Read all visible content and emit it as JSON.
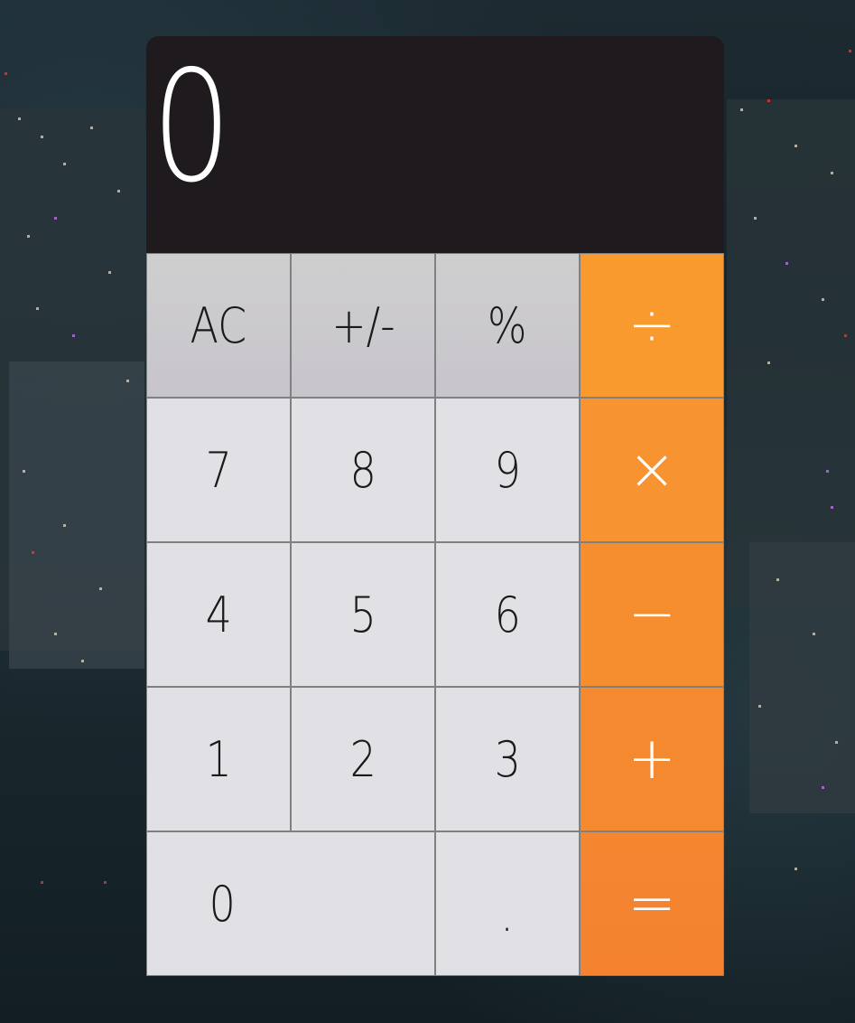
{
  "display": {
    "value": "0"
  },
  "keys": {
    "clear": "AC",
    "sign": "+/-",
    "percent": "%",
    "divide": "÷",
    "seven": "7",
    "eight": "8",
    "nine": "9",
    "multiply": "×",
    "four": "4",
    "five": "5",
    "six": "6",
    "subtract": "−",
    "one": "1",
    "two": "2",
    "three": "3",
    "add": "+",
    "zero": "0",
    "decimal": ".",
    "equals": "="
  },
  "colors": {
    "display_bg": "#1f1a1d",
    "function_key": "#cbc9cd",
    "number_key": "#e0e0e5",
    "operator_top": "#f99b2f",
    "operator_bottom": "#f48430",
    "border": "#808080"
  }
}
